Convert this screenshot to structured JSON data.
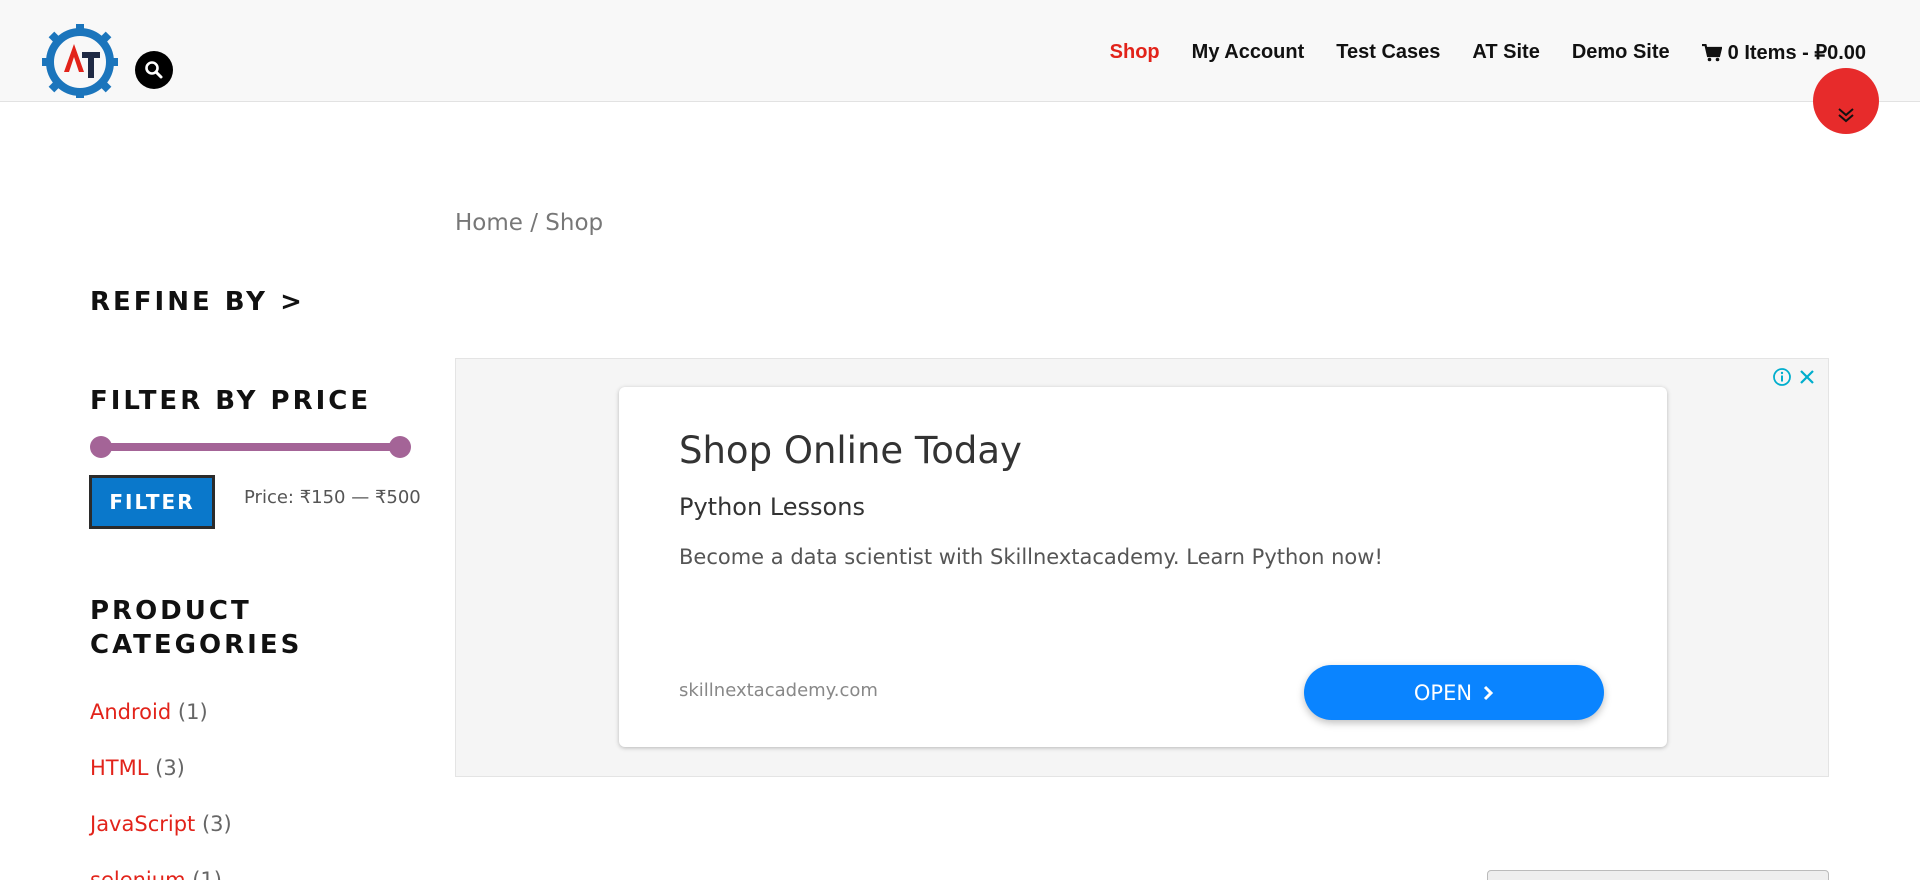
{
  "header": {
    "nav": [
      {
        "label": "Shop",
        "active": true
      },
      {
        "label": "My Account"
      },
      {
        "label": "Test Cases"
      },
      {
        "label": "AT Site"
      },
      {
        "label": "Demo Site"
      }
    ],
    "cart_label": "0 Items - ₽0.00"
  },
  "breadcrumb": "Home / Shop",
  "sidebar": {
    "refine_label": "REFINE BY >",
    "filter_title": "FILTER BY PRICE",
    "filter_button": "FILTER",
    "price_range": "Price: ₹150 — ₹500",
    "categories_title": "PRODUCT CATEGORIES",
    "categories": [
      {
        "name": "Android",
        "count": "(1)"
      },
      {
        "name": "HTML",
        "count": "(3)"
      },
      {
        "name": "JavaScript",
        "count": "(3)"
      },
      {
        "name": "selenium",
        "count": "(1)"
      }
    ]
  },
  "ad": {
    "headline": "Shop Online Today",
    "subheadline": "Python Lessons",
    "body": "Become a data scientist with Skillnextacademy. Learn Python now!",
    "domain": "skillnextacademy.com",
    "cta": "OPEN"
  },
  "colors": {
    "accent_red": "#e2231a",
    "filter_blue": "#0a78cb",
    "slider_purple": "#a46497",
    "ad_button_blue": "#0a84ff"
  },
  "icons": [
    "search-icon",
    "cart-icon",
    "chevron-double-down-icon",
    "ad-info-icon",
    "ad-close-icon",
    "chevron-right-icon"
  ]
}
